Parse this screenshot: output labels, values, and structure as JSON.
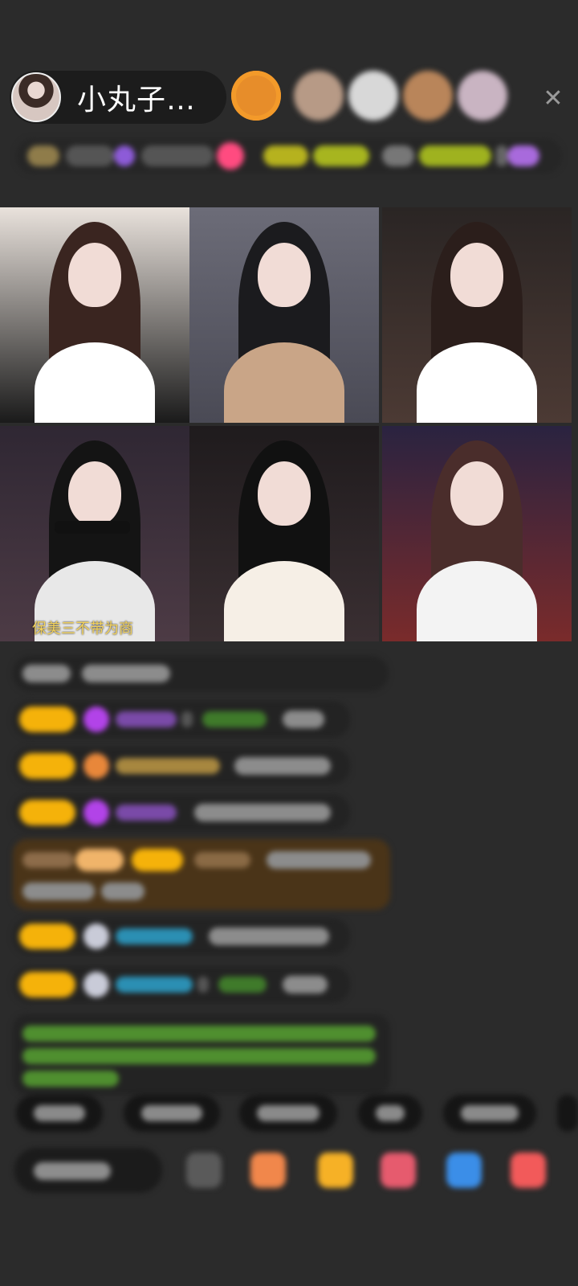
{
  "host": {
    "name": "小丸子…",
    "avatar_icon": "host-avatar"
  },
  "viewers": [
    {
      "icon": "viewer-avatar-1",
      "color": "#e78d2a"
    },
    {
      "icon": "viewer-avatar-2",
      "color": "#b79a86"
    },
    {
      "icon": "viewer-avatar-3",
      "color": "#d8d8d8"
    },
    {
      "icon": "viewer-avatar-4",
      "color": "#b9855a"
    },
    {
      "icon": "viewer-avatar-5",
      "color": "#c9b4c2"
    }
  ],
  "close_icon": "close-icon",
  "close_glyph": "✕",
  "stream_tiles": [
    {
      "bg": "#e9e2dc",
      "accent": "#1a1a1a",
      "hair": "#3a2520",
      "top": "#ffffff"
    },
    {
      "bg": "#6c6c78",
      "accent": "#4a4a55",
      "hair": "#1b1b1e",
      "top": "#c9a587"
    },
    {
      "bg": "#2a2524",
      "accent": "#4c3a34",
      "hair": "#2b1e1b",
      "top": "#ffffff"
    },
    {
      "bg": "#2f2733",
      "accent": "#4d3b45",
      "hair": "#141414",
      "top": "#e8e8e8",
      "caption": "保美三不带为商"
    },
    {
      "bg": "#1f1b1d",
      "accent": "#3a2f32",
      "hair": "#111111",
      "top": "#f6efe6"
    },
    {
      "bg": "#2a2340",
      "accent": "#7a2b2b",
      "hair": "#4a2d2b",
      "top": "#f3f3f3"
    }
  ],
  "colors": {
    "badge": "#f5b20a",
    "purple_gem": "#b243e8",
    "orange_gem": "#e8873a",
    "blue_name": "#2b8fb3",
    "green_text": "#6fbf45",
    "highlight_bg": "#4a3418"
  },
  "tools": [
    {
      "icon": "comment-box-icon",
      "color": "#5a5a5a"
    },
    {
      "icon": "gift-box-icon",
      "color": "#f1874b"
    },
    {
      "icon": "treasure-icon",
      "color": "#f6b126"
    },
    {
      "icon": "game-icon",
      "color": "#e65b6e"
    },
    {
      "icon": "chat-bubble-icon",
      "color": "#3b8ee8"
    },
    {
      "icon": "app-grid-icon",
      "color": "#f25a5a"
    }
  ]
}
